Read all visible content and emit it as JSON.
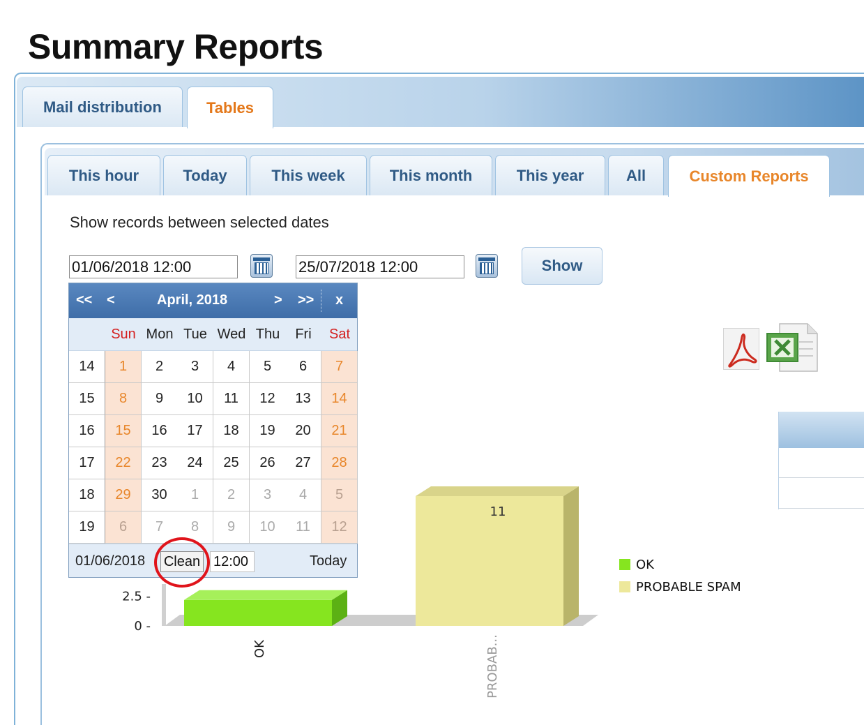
{
  "page": {
    "title": "Summary Reports"
  },
  "main_tabs": [
    {
      "label": "Mail distribution",
      "active": false
    },
    {
      "label": "Tables",
      "active": true
    }
  ],
  "sub_tabs": [
    {
      "label": "This hour",
      "active": false
    },
    {
      "label": "Today",
      "active": false
    },
    {
      "label": "This week",
      "active": false
    },
    {
      "label": "This month",
      "active": false
    },
    {
      "label": "This year",
      "active": false
    },
    {
      "label": "All",
      "active": false
    },
    {
      "label": "Custom Reports",
      "active": true
    }
  ],
  "filter": {
    "instructions": "Show records between selected dates",
    "start_date": "01/06/2018 12:00",
    "end_date": "25/07/2018 12:00",
    "show_label": "Show"
  },
  "calendar": {
    "nav": {
      "prev_year": "<<",
      "prev_month": "<",
      "next_month": ">",
      "next_year": ">>",
      "close": "x"
    },
    "month_title": "April, 2018",
    "day_names": [
      "Sun",
      "Mon",
      "Tue",
      "Wed",
      "Thu",
      "Fri",
      "Sat"
    ],
    "weeks": [
      {
        "week": "14",
        "days": [
          "1",
          "2",
          "3",
          "4",
          "5",
          "6",
          "7"
        ]
      },
      {
        "week": "15",
        "days": [
          "8",
          "9",
          "10",
          "11",
          "12",
          "13",
          "14"
        ]
      },
      {
        "week": "16",
        "days": [
          "15",
          "16",
          "17",
          "18",
          "19",
          "20",
          "21"
        ]
      },
      {
        "week": "17",
        "days": [
          "22",
          "23",
          "24",
          "25",
          "26",
          "27",
          "28"
        ]
      },
      {
        "week": "18",
        "days": [
          "29",
          "30",
          "1",
          "2",
          "3",
          "4",
          "5"
        ]
      },
      {
        "week": "19",
        "days": [
          "6",
          "7",
          "8",
          "9",
          "10",
          "11",
          "12"
        ]
      }
    ],
    "footer": {
      "selected_date": "01/06/2018",
      "clean_label": "Clean",
      "time": "12:00",
      "today_label": "Today"
    }
  },
  "colors": {
    "ok": "#86e51f",
    "probable_spam": "#ede89b",
    "active_tab": "#e8862a",
    "tab_text": "#2f5a85",
    "highlight": "#e0141b"
  },
  "chart_data": {
    "type": "bar",
    "categories": [
      "OK",
      "PROBAB..."
    ],
    "series": [
      {
        "name": "OK",
        "values": [
          2.2,
          0
        ]
      },
      {
        "name": "PROBABLE SPAM",
        "values": [
          0,
          11
        ]
      }
    ],
    "data_labels": [
      "",
      "11"
    ],
    "y_ticks": [
      "0",
      "2.5"
    ],
    "legend": [
      "OK",
      "PROBABLE SPAM"
    ],
    "legend_position": "right",
    "ylim": [
      0,
      12
    ]
  }
}
